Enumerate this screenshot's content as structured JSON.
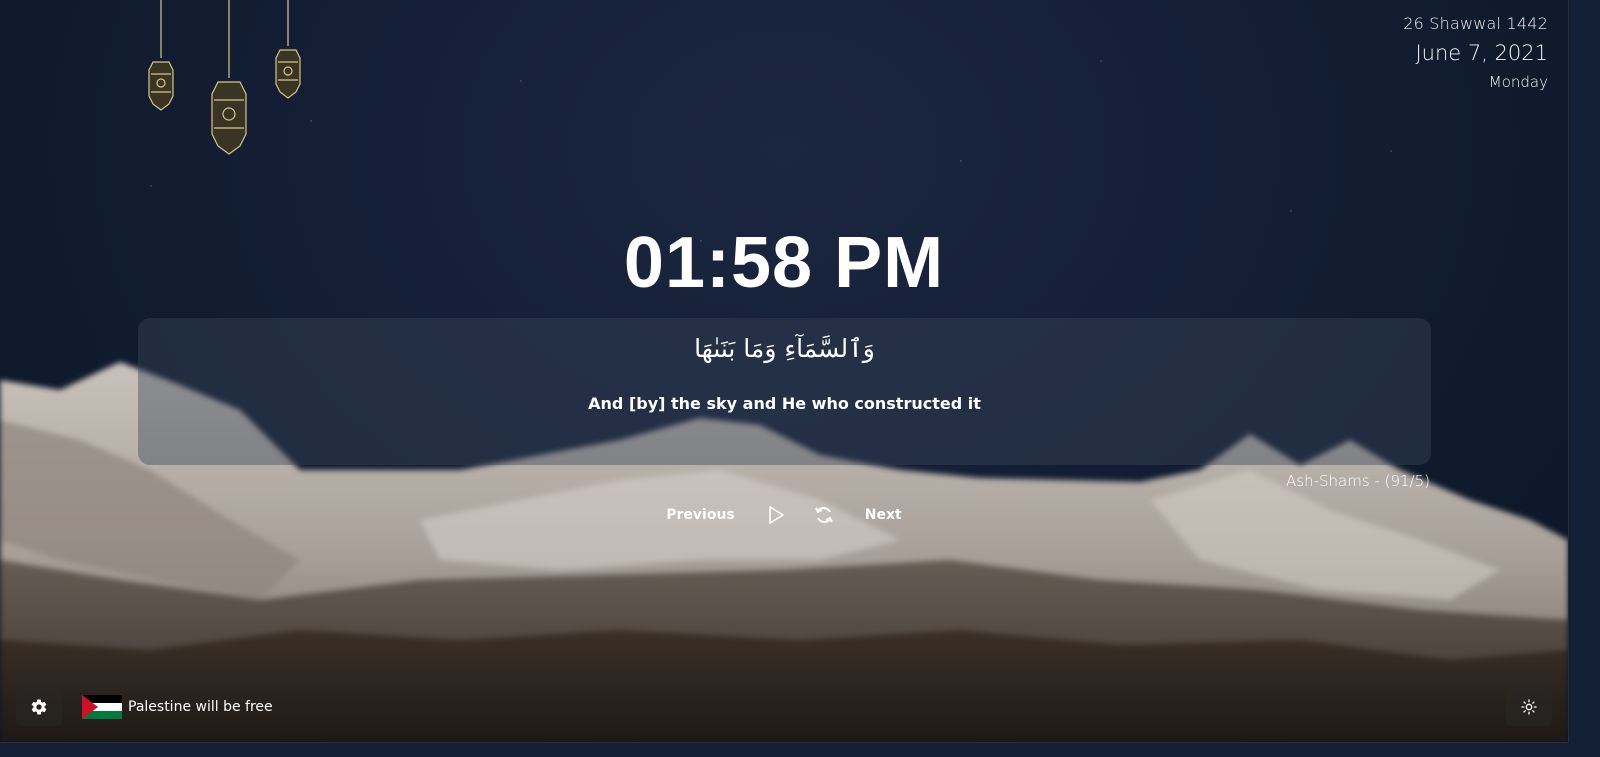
{
  "date": {
    "hijri": "26 Shawwal 1442",
    "gregorian": "June 7, 2021",
    "weekday": "Monday"
  },
  "clock": {
    "time": "01:58 PM"
  },
  "verse": {
    "arabic": "وَٱلسَّمَآءِ وَمَا بَنَىٰهَا",
    "translation": "And [by] the sky and He who constructed it",
    "reference": "Ash-Shams - (91/5)"
  },
  "controls": {
    "previous_label": "Previous",
    "next_label": "Next",
    "play_icon": "play-icon",
    "refresh_icon": "refresh-icon"
  },
  "footer": {
    "settings_icon": "gear-icon",
    "flag_icon": "palestine-flag-icon",
    "flag_text": "Palestine will be free",
    "theme_icon": "sun-icon"
  },
  "colors": {
    "sky": "#142036",
    "lantern_gold": "#d9c48a",
    "flag_red": "#ce1126",
    "flag_green": "#007a3d"
  }
}
